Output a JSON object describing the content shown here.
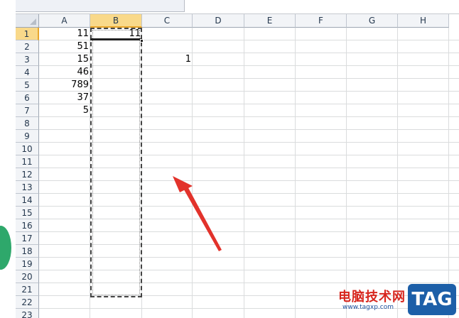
{
  "spreadsheet": {
    "columns": [
      "A",
      "B",
      "C",
      "D",
      "E",
      "F",
      "G",
      "H"
    ],
    "selected_column": "B",
    "rows": [
      "1",
      "2",
      "3",
      "4",
      "5",
      "6",
      "7",
      "8",
      "9",
      "10",
      "11",
      "12",
      "13",
      "14",
      "15",
      "16",
      "17",
      "18",
      "19",
      "20",
      "21",
      "22",
      "23"
    ],
    "selected_row": "1",
    "cells": {
      "A1": "11",
      "A2": "51",
      "A3": "15",
      "A4": "46",
      "A5": "789",
      "A6": "37",
      "A7": "5",
      "B1": "11",
      "C3": "1"
    },
    "active_cell": "B1",
    "copy_range": "B1:B21"
  },
  "watermark": {
    "site_name": "电脑技术网",
    "url": "www.tagxp.com",
    "tag": "TAG"
  },
  "colors": {
    "arrow": "#e2322b",
    "selected_header": "#f9d98a",
    "gridline": "#dadcdd"
  }
}
